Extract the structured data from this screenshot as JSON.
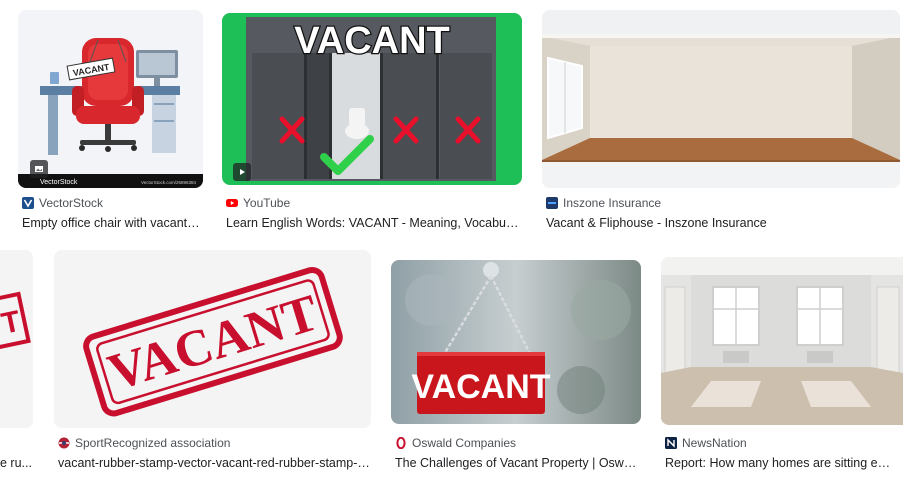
{
  "results": [
    {
      "source": "VectorStock",
      "title": "Empty office chair with vacant sign vector image",
      "image_text": "VACANT",
      "watermark_left": "VectorStock",
      "watermark_right": "VectorStock.com/26896384",
      "favicon": "vectorstock-icon",
      "badge": "image-icon"
    },
    {
      "source": "YouTube",
      "title": "Learn English Words: VACANT - Meaning, Vocabulary with Pictures",
      "image_text": "VACANT",
      "favicon": "youtube-icon",
      "badge": "play-icon"
    },
    {
      "source": "Inszone Insurance",
      "title": "Vacant & Fliphouse - Inszone Insurance",
      "favicon": "inszone-icon"
    },
    {
      "source": "",
      "title": "e ru...",
      "image_text": "T",
      "favicon": ""
    },
    {
      "source": "SportRecognized association",
      "title": "vacant-rubber-stamp-vector-vacant-red-rubber-stamp-vector",
      "image_text": "VACANT",
      "favicon": "sportrecognized-icon"
    },
    {
      "source": "Oswald Companies",
      "title": "The Challenges of Vacant Property | Oswald Companies",
      "image_text": "VACANT",
      "favicon": "oswald-icon"
    },
    {
      "source": "NewsNation",
      "title": "Report: How many homes are sitting empty in the US?",
      "favicon": "newsnation-icon"
    }
  ],
  "colors": {
    "youtube_red": "#ff0000",
    "stamp_red": "#c8102e",
    "green_screen": "#1db954"
  }
}
